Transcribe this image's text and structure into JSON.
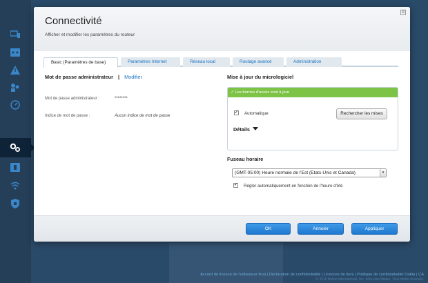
{
  "sidebar": {
    "items": [
      {
        "icon": "devices-icon"
      },
      {
        "icon": "network-map-icon"
      },
      {
        "icon": "warning-icon"
      },
      {
        "icon": "parental-controls-icon"
      },
      {
        "icon": "speed-test-icon"
      },
      {
        "icon": "settings-icon"
      },
      {
        "icon": "external-storage-icon"
      },
      {
        "icon": "wireless-icon"
      },
      {
        "icon": "security-icon"
      }
    ]
  },
  "modal": {
    "title": "Connectivité",
    "subtitle": "Afficher et modifier les paramètres du routeur",
    "close_label": "⊠"
  },
  "tabs": [
    {
      "label": "Basic (Paramètres de base)"
    },
    {
      "label": "Paramètres Internet"
    },
    {
      "label": "Réseau local"
    },
    {
      "label": "Routage avancé"
    },
    {
      "label": "Administration"
    }
  ],
  "admin": {
    "heading": "Mot de passe administrateur",
    "separator": "|",
    "edit_link": "Modifier",
    "password_label": "Mot de passe administrateur :",
    "password_value": "********",
    "hint_label": "Indice de mot de passe :",
    "hint_value": "Aucun indice de mot de passe"
  },
  "firmware": {
    "heading": "Mise à jour du micrologiciel",
    "status": "✓ Les bornes d'accès sont à jour",
    "auto_label": "Automatique",
    "auto_checked": true,
    "check_button": "Rechercher les mises",
    "details_label": "Détails"
  },
  "timezone": {
    "heading": "Fuseau horaire",
    "selected": "(GMT-05:00) Heure normale de l'Est (Etats-Unis et Canada)",
    "dst_label": "Régler automatiquement en fonction de l'heure d'été",
    "dst_checked": true
  },
  "footer_buttons": {
    "ok": "OK",
    "cancel": "Annuler",
    "apply": "Appliquer"
  },
  "page_footer": {
    "links": "Accord de licence de l'utilisateur final | Déclaration de confidentialité | Licences de tiers | Politique de confidentialité Ookla | CA",
    "copyright": "© 2018 Belkin International, Inc. et/ou ses filiales. Tous droits réservés."
  },
  "colors": {
    "accent": "#1a73c4",
    "success": "#7cc346",
    "button_blue": "#2a86dc"
  }
}
